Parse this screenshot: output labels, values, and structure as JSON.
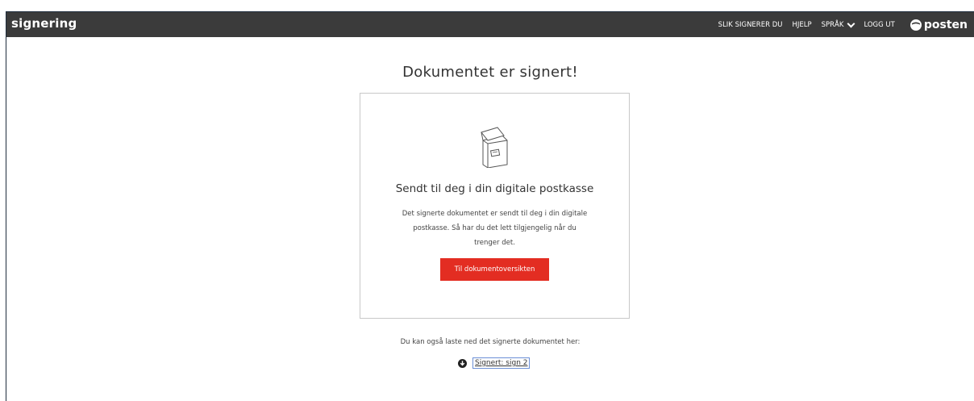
{
  "header": {
    "brand": "signering",
    "nav": {
      "how_to_sign": "SLIK SIGNERER DU",
      "help": "HJELP",
      "language": "SPRÅK",
      "logout": "LOGG UT"
    },
    "logo_text": "posten"
  },
  "main": {
    "title": "Dokumentet er signert!",
    "card": {
      "icon": "mailbox-icon",
      "title": "Sendt til deg i din digitale postkasse",
      "text_lines": [
        "Det signerte dokumentet er sendt til deg i din digitale",
        "postkasse. Så har du det lett tilgjengelig når du",
        "trenger det."
      ],
      "button_label": "Til dokumentoversikten"
    },
    "download": {
      "text": "Du kan også laste ned det signerte dokumentet her:",
      "icon": "download-circle-icon",
      "link_label": "Signert: sign 2"
    }
  },
  "colors": {
    "header_bg": "#3b3b3b",
    "accent": "#e32d22",
    "text": "#333333"
  }
}
